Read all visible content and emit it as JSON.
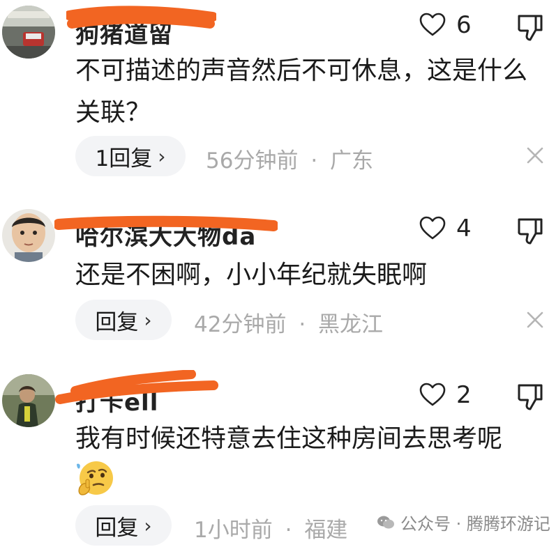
{
  "comments": [
    {
      "username": "狗猪道留",
      "likes": "6",
      "text": "不可描述的声音然后不可休息，这是什么关联？",
      "reply_label": "1回复",
      "time": "56分钟前",
      "location": "广东",
      "avatar": "photo-street-taxi"
    },
    {
      "username": "哈尔滨大大物da",
      "likes": "4",
      "text": "还是不困啊，小小年纪就失眠啊",
      "reply_label": "回复",
      "time": "42分钟前",
      "location": "黑龙江",
      "avatar": "photo-child"
    },
    {
      "username": "打卡ell",
      "likes": "2",
      "text": "我有时候还特意去住这种房间去思考呢",
      "emoji": "thinking-face-emoji",
      "reply_label": "回复",
      "time": "1小时前",
      "location": "福建",
      "avatar": "photo-person-outdoor"
    }
  ],
  "separator": "·",
  "watermark": "公众号 · 腾腾环游记",
  "colors": {
    "scribble": "#f26522",
    "pill_bg": "#f3f4f6",
    "meta_text": "#a9a9a9",
    "emoji_yellow": "#f7c948"
  }
}
